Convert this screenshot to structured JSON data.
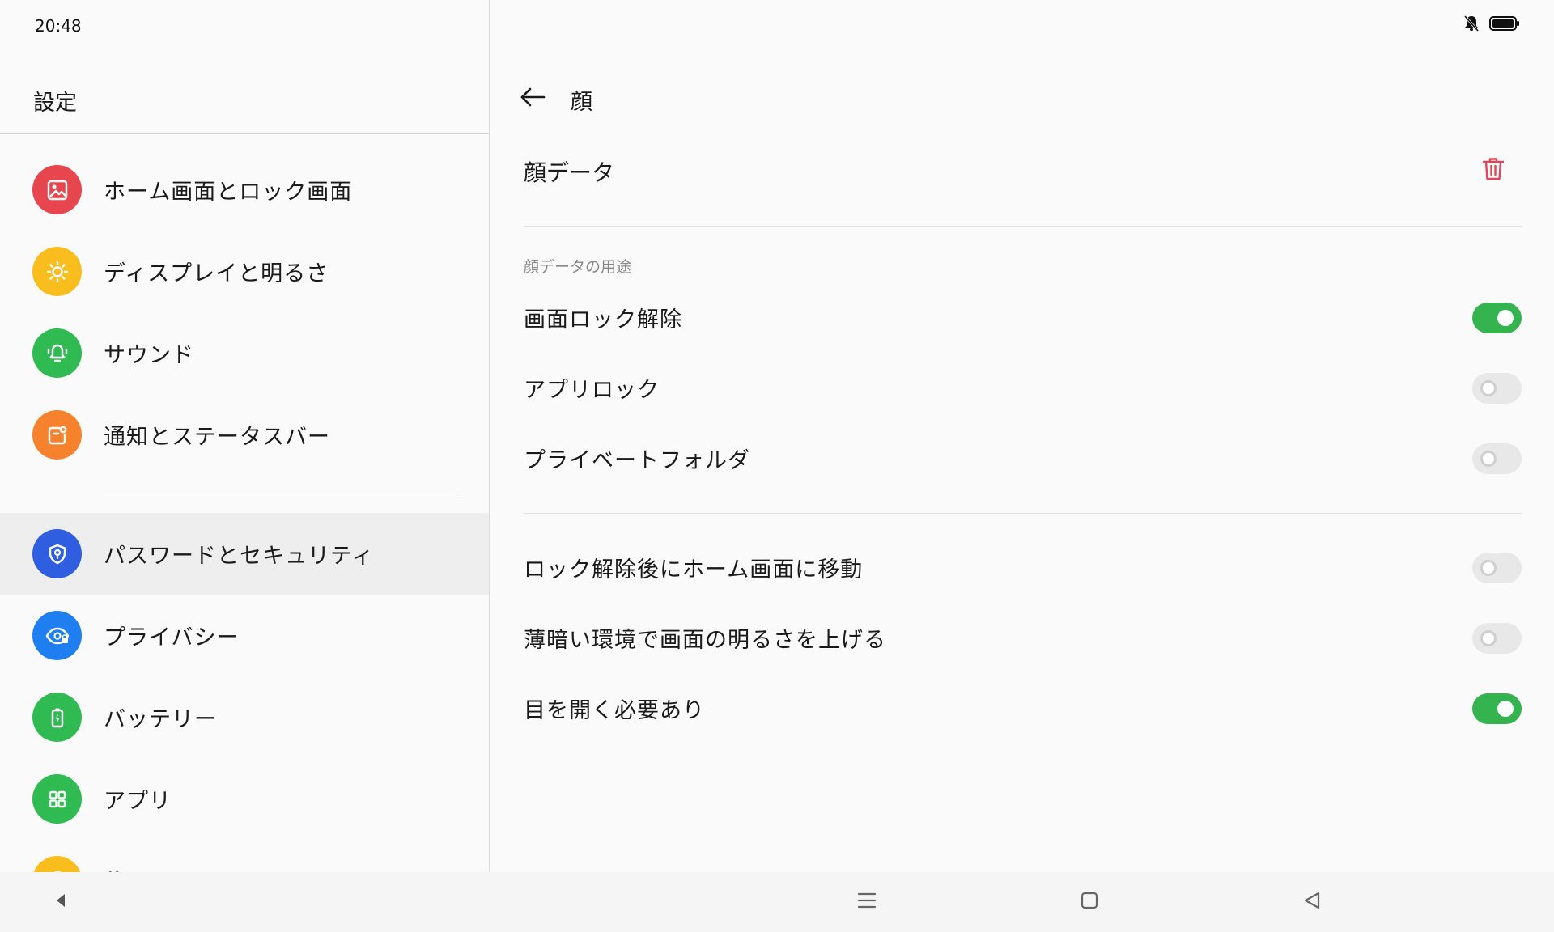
{
  "status_bar": {
    "time": "20:48",
    "icons": [
      "bell-muted-icon",
      "battery-icon"
    ]
  },
  "left_pane": {
    "title": "設定",
    "items": [
      {
        "label": "ホーム画面とロック画面",
        "icon": "image-icon",
        "color": "#e8464f"
      },
      {
        "label": "ディスプレイと明るさ",
        "icon": "sun-icon",
        "color": "#f9be1e"
      },
      {
        "label": "サウンド",
        "icon": "bell-icon",
        "color": "#30ba52"
      },
      {
        "label": "通知とステータスバー",
        "icon": "notification-icon",
        "color": "#f7822d"
      },
      {
        "label": "パスワードとセキュリティ",
        "icon": "shield-icon",
        "color": "#2f5fe0",
        "selected": true
      },
      {
        "label": "プライバシー",
        "icon": "eye-lock-icon",
        "color": "#1f7ff0"
      },
      {
        "label": "バッテリー",
        "icon": "battery-icon",
        "color": "#30ba52"
      },
      {
        "label": "アプリ",
        "icon": "apps-grid-icon",
        "color": "#30ba52"
      },
      {
        "label": "位置",
        "icon": "location-icon",
        "color": "#f9be1e"
      }
    ]
  },
  "right_pane": {
    "title": "顔",
    "face_data_label": "顔データ",
    "section_header": "顔データの用途",
    "usage_settings": [
      {
        "label": "画面ロック解除",
        "on": true
      },
      {
        "label": "アプリロック",
        "on": false
      },
      {
        "label": "プライベートフォルダ",
        "on": false
      }
    ],
    "other_settings": [
      {
        "label": "ロック解除後にホーム画面に移動",
        "on": false
      },
      {
        "label": "薄暗い環境で画面の明るさを上げる",
        "on": false
      },
      {
        "label": "目を開く必要あり",
        "on": true
      }
    ]
  },
  "colors": {
    "accent_green": "#35b34f",
    "delete_red": "#e0455a"
  },
  "nav_bar": {
    "buttons": [
      "triangle-left-small-icon",
      "menu-icon",
      "home-square-icon",
      "back-triangle-icon"
    ]
  }
}
